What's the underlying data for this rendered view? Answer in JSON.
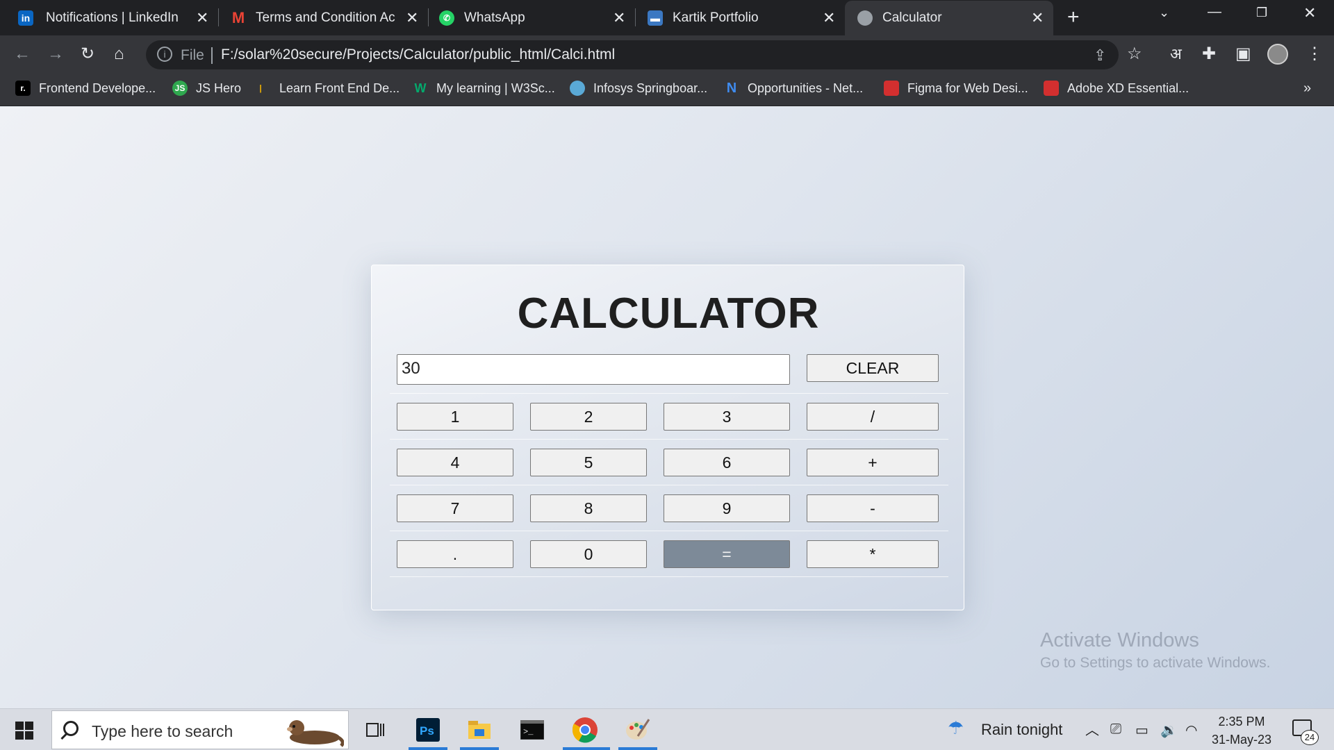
{
  "browser": {
    "tabs": [
      {
        "label": "Notifications | LinkedIn",
        "icon": "linkedin-icon"
      },
      {
        "label": "Terms and Condition Acc",
        "icon": "gmail-icon"
      },
      {
        "label": "WhatsApp",
        "icon": "whatsapp-icon"
      },
      {
        "label": "Kartik Portfolio",
        "icon": "briefcase-icon"
      },
      {
        "label": "Calculator",
        "icon": "globe-icon",
        "active": true
      }
    ],
    "address": {
      "scheme_label": "File",
      "url": "F:/solar%20secure/Projects/Calculator/public_html/Calci.html"
    },
    "bookmarks": [
      {
        "label": "Frontend Develope...",
        "icon": "r-icon"
      },
      {
        "label": "JS Hero",
        "icon": "js-icon"
      },
      {
        "label": "Learn Front End De...",
        "icon": "bars-icon"
      },
      {
        "label": "My learning | W3Sc...",
        "icon": "w3-icon"
      },
      {
        "label": "Infosys Springboar...",
        "icon": "cloud-icon"
      },
      {
        "label": "Opportunities - Net...",
        "icon": "n-icon"
      },
      {
        "label": "Figma for Web Desi...",
        "icon": "slides-icon"
      },
      {
        "label": "Adobe XD Essential...",
        "icon": "slides-icon"
      }
    ],
    "extension_glyph": "अ"
  },
  "calculator": {
    "title": "CALCULATOR",
    "display_value": "30",
    "clear_label": "CLEAR",
    "rows": [
      [
        "1",
        "2",
        "3",
        "/"
      ],
      [
        "4",
        "5",
        "6",
        "+"
      ],
      [
        "7",
        "8",
        "9",
        "-"
      ],
      [
        ".",
        "0",
        "=",
        "*"
      ]
    ],
    "equals_color": "#7d8a98"
  },
  "watermark": {
    "line1": "Activate Windows",
    "line2": "Go to Settings to activate Windows."
  },
  "taskbar": {
    "search_placeholder": "Type here to search",
    "weather": "Rain tonight",
    "time": "2:35 PM",
    "date": "31-May-23",
    "notification_count": "24",
    "apps": [
      "task-view-icon",
      "photoshop-icon",
      "file-explorer-icon",
      "terminal-icon",
      "chrome-icon",
      "paint-icon"
    ]
  }
}
